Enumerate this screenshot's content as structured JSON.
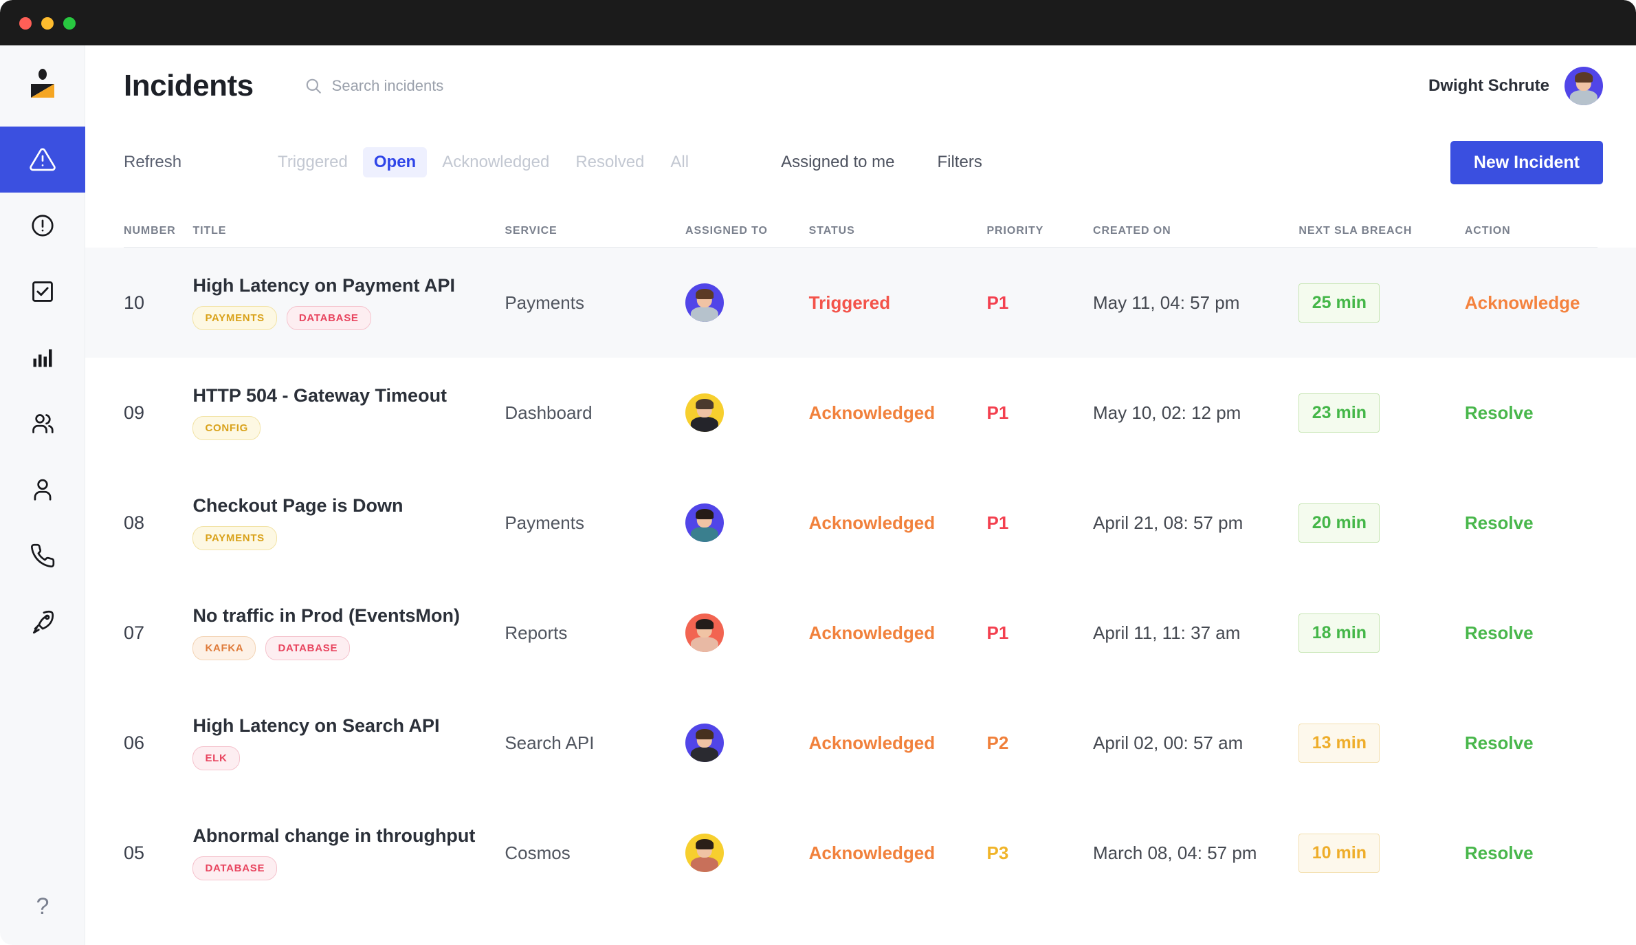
{
  "window": {
    "traffic_lights": [
      "close",
      "minimize",
      "maximize"
    ]
  },
  "sidebar": {
    "logo": "zenduty-logo",
    "items": [
      {
        "icon": "alert-triangle-icon",
        "name": "incidents",
        "active": true
      },
      {
        "icon": "alert-circle-icon",
        "name": "alerts",
        "active": false
      },
      {
        "icon": "checkbox-icon",
        "name": "tasks",
        "active": false
      },
      {
        "icon": "bar-chart-icon",
        "name": "analytics",
        "active": false
      },
      {
        "icon": "users-icon",
        "name": "teams",
        "active": false
      },
      {
        "icon": "user-icon",
        "name": "people",
        "active": false
      },
      {
        "icon": "phone-icon",
        "name": "on-call",
        "active": false
      },
      {
        "icon": "rocket-icon",
        "name": "deployments",
        "active": false
      }
    ],
    "help_label": "?"
  },
  "header": {
    "title": "Incidents",
    "search_placeholder": "Search incidents",
    "search_icon": "search-icon",
    "user_name": "Dwight Schrute",
    "user_avatar_bg": "#5145e8"
  },
  "toolbar": {
    "refresh_label": "Refresh",
    "tabs": [
      {
        "label": "Triggered",
        "active": false
      },
      {
        "label": "Open",
        "active": true
      },
      {
        "label": "Acknowledged",
        "active": false
      },
      {
        "label": "Resolved",
        "active": false
      },
      {
        "label": "All",
        "active": false
      }
    ],
    "assigned_to_me_label": "Assigned to me",
    "filters_label": "Filters",
    "new_incident_label": "New Incident",
    "accent_color": "#3a4fe0"
  },
  "table": {
    "columns": [
      "NUMBER",
      "TITLE",
      "SERVICE",
      "ASSIGNED TO",
      "STATUS",
      "PRIORITY",
      "CREATED ON",
      "NEXT SLA BREACH",
      "ACTION"
    ],
    "rows": [
      {
        "number": "10",
        "title": "High Latency on Payment API",
        "tags": [
          {
            "label": "PAYMENTS",
            "tone": "yellow"
          },
          {
            "label": "DATABASE",
            "tone": "pink"
          }
        ],
        "service": "Payments",
        "avatar_bg": "#5145e8",
        "avatar_hair": "#5b3a26",
        "avatar_body": "#b6c2cc",
        "status": "Triggered",
        "status_tone": "triggered",
        "priority": "P1",
        "priority_tone": "p1",
        "created_on": "May 11, 04: 57 pm",
        "sla": "25 min",
        "sla_tone": "green",
        "action": "Acknowledge",
        "action_tone": "ack",
        "highlight": true
      },
      {
        "number": "09",
        "title": "HTTP 504 - Gateway Timeout",
        "tags": [
          {
            "label": "CONFIG",
            "tone": "yellow"
          }
        ],
        "service": "Dashboard",
        "avatar_bg": "#f7cf2e",
        "avatar_hair": "#4b3a2e",
        "avatar_body": "#24242a",
        "status": "Acknowledged",
        "status_tone": "acknowledged",
        "priority": "P1",
        "priority_tone": "p1",
        "created_on": "May 10, 02: 12 pm",
        "sla": "23 min",
        "sla_tone": "green",
        "action": "Resolve",
        "action_tone": "res",
        "highlight": false
      },
      {
        "number": "08",
        "title": "Checkout Page is Down",
        "tags": [
          {
            "label": "PAYMENTS",
            "tone": "yellow"
          }
        ],
        "service": "Payments",
        "avatar_bg": "#5145e8",
        "avatar_hair": "#261c17",
        "avatar_body": "#3a7f8e",
        "status": "Acknowledged",
        "status_tone": "acknowledged",
        "priority": "P1",
        "priority_tone": "p1",
        "created_on": "April  21, 08: 57 pm",
        "sla": "20 min",
        "sla_tone": "green",
        "action": "Resolve",
        "action_tone": "res",
        "highlight": false
      },
      {
        "number": "07",
        "title": "No traffic in Prod (EventsMon)",
        "tags": [
          {
            "label": "KAFKA",
            "tone": "orange"
          },
          {
            "label": "DATABASE",
            "tone": "pink"
          }
        ],
        "service": "Reports",
        "avatar_bg": "#f26451",
        "avatar_hair": "#231c1a",
        "avatar_body": "#e8b9a4",
        "status": "Acknowledged",
        "status_tone": "acknowledged",
        "priority": "P1",
        "priority_tone": "p1",
        "created_on": "April  11, 11: 37 am",
        "sla": "18 min",
        "sla_tone": "green",
        "action": "Resolve",
        "action_tone": "res",
        "highlight": false
      },
      {
        "number": "06",
        "title": "High Latency on Search API",
        "tags": [
          {
            "label": "ELK",
            "tone": "pink"
          }
        ],
        "service": "Search API",
        "avatar_bg": "#5145e8",
        "avatar_hair": "#46301f",
        "avatar_body": "#2a2a30",
        "status": "Acknowledged",
        "status_tone": "acknowledged",
        "priority": "P2",
        "priority_tone": "p2",
        "created_on": "April  02, 00: 57 am",
        "sla": "13 min",
        "sla_tone": "amber",
        "action": "Resolve",
        "action_tone": "res",
        "highlight": false
      },
      {
        "number": "05",
        "title": "Abnormal change in throughput",
        "tags": [
          {
            "label": "DATABASE",
            "tone": "pink"
          }
        ],
        "service": "Cosmos",
        "avatar_bg": "#f7cf2e",
        "avatar_hair": "#2b2018",
        "avatar_body": "#c8705a",
        "status": "Acknowledged",
        "status_tone": "acknowledged",
        "priority": "P3",
        "priority_tone": "p3",
        "created_on": "March 08, 04: 57 pm",
        "sla": "10 min",
        "sla_tone": "amber",
        "action": "Resolve",
        "action_tone": "res",
        "highlight": false
      }
    ]
  }
}
